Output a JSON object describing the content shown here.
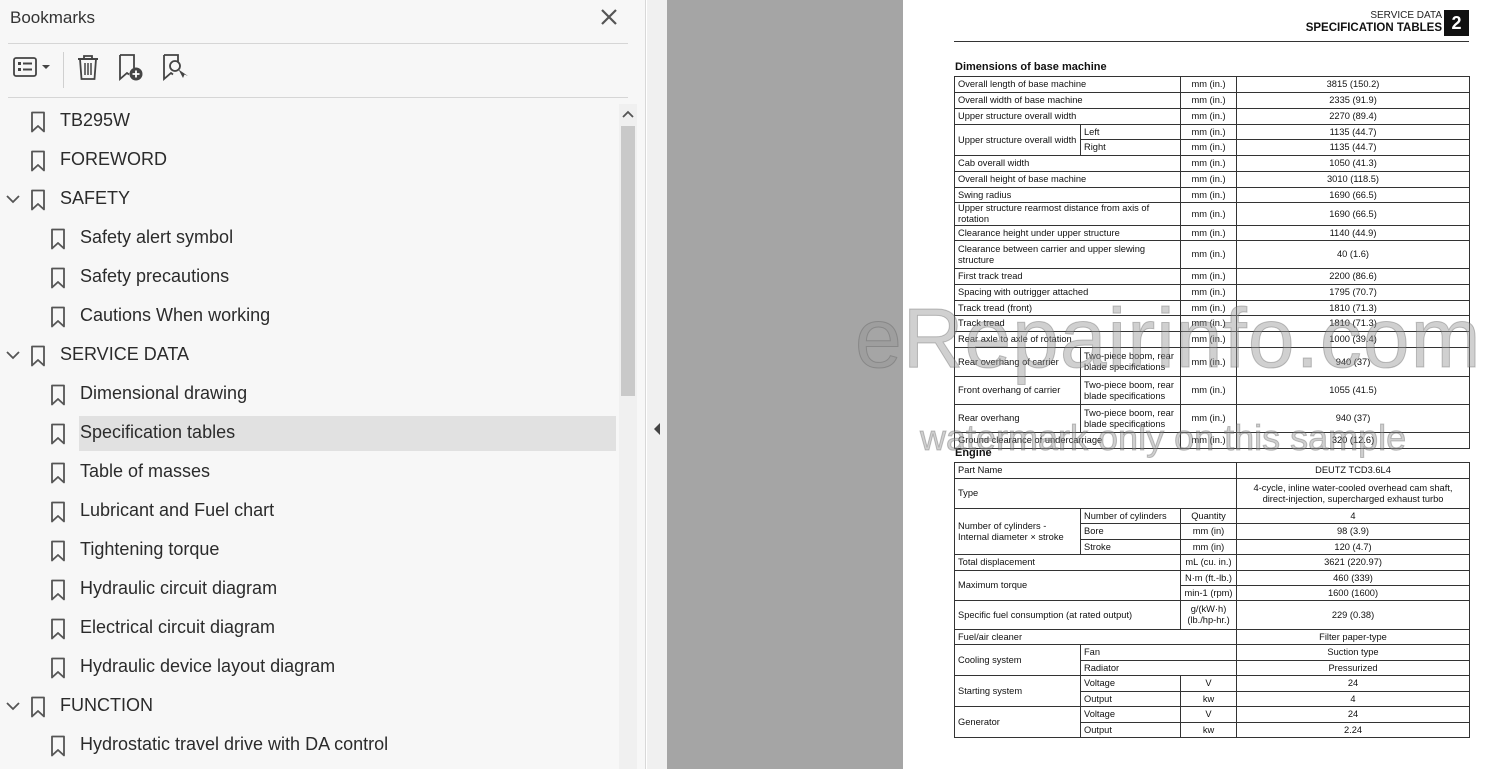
{
  "bookmarks_panel": {
    "title": "Bookmarks",
    "items": [
      {
        "label": "TB295W",
        "level": 0,
        "expanded": false,
        "selected": false
      },
      {
        "label": "FOREWORD",
        "level": 0,
        "expanded": false,
        "selected": false
      },
      {
        "label": "SAFETY",
        "level": 0,
        "expanded": true,
        "selected": false
      },
      {
        "label": "Safety alert symbol",
        "level": 1,
        "selected": false
      },
      {
        "label": "Safety precautions",
        "level": 1,
        "selected": false
      },
      {
        "label": "Cautions When working",
        "level": 1,
        "selected": false
      },
      {
        "label": "SERVICE DATA",
        "level": 0,
        "expanded": true,
        "selected": false
      },
      {
        "label": "Dimensional drawing",
        "level": 1,
        "selected": false
      },
      {
        "label": "Specification tables",
        "level": 1,
        "selected": true
      },
      {
        "label": "Table of masses",
        "level": 1,
        "selected": false
      },
      {
        "label": "Lubricant and Fuel chart",
        "level": 1,
        "selected": false
      },
      {
        "label": "Tightening torque",
        "level": 1,
        "selected": false
      },
      {
        "label": "Hydraulic circuit diagram",
        "level": 1,
        "selected": false
      },
      {
        "label": "Electrical circuit diagram",
        "level": 1,
        "selected": false
      },
      {
        "label": "Hydraulic device layout diagram",
        "level": 1,
        "selected": false
      },
      {
        "label": "FUNCTION",
        "level": 0,
        "expanded": true,
        "selected": false
      },
      {
        "label": "Hydrostatic travel drive with DA control",
        "level": 1,
        "selected": false
      }
    ],
    "toolbar_icons": [
      "options-menu-icon",
      "delete-icon",
      "add-bookmark-icon",
      "find-bookmark-icon"
    ]
  },
  "document": {
    "header": {
      "section": "SERVICE DATA",
      "title": "SPECIFICATION TABLES",
      "chapter_number": "2"
    },
    "dimensions": {
      "title": "Dimensions of base machine",
      "rows": [
        {
          "item": "Overall length of base machine",
          "sub": "",
          "unit": "mm (in.)",
          "value": "3815 (150.2)"
        },
        {
          "item": "Overall width of base machine",
          "sub": "",
          "unit": "mm (in.)",
          "value": "2335 (91.9)"
        },
        {
          "item": "Upper structure overall width",
          "sub": "",
          "unit": "mm (in.)",
          "value": "2270 (89.4)"
        },
        {
          "item": "Upper structure overall width",
          "sub": "Left",
          "unit": "mm (in.)",
          "value": "1135 (44.7)"
        },
        {
          "item": "",
          "sub": "Right",
          "unit": "mm (in.)",
          "value": "1135 (44.7)"
        },
        {
          "item": "Cab overall width",
          "sub": "",
          "unit": "mm (in.)",
          "value": "1050 (41.3)"
        },
        {
          "item": "Overall height of base machine",
          "sub": "",
          "unit": "mm (in.)",
          "value": "3010 (118.5)"
        },
        {
          "item": "Swing radius",
          "sub": "",
          "unit": "mm (in.)",
          "value": "1690 (66.5)"
        },
        {
          "item": "Upper structure rearmost distance from axis of rotation",
          "sub": "",
          "unit": "mm (in.)",
          "value": "1690 (66.5)"
        },
        {
          "item": "Clearance height under upper structure",
          "sub": "",
          "unit": "mm (in.)",
          "value": "1140 (44.9)"
        },
        {
          "item": "Clearance between carrier and upper slewing structure",
          "sub": "",
          "unit": "mm (in.)",
          "value": "40 (1.6)"
        },
        {
          "item": "First track tread",
          "sub": "",
          "unit": "mm (in.)",
          "value": "2200 (86.6)"
        },
        {
          "item": "Spacing with outrigger attached",
          "sub": "",
          "unit": "mm (in.)",
          "value": "1795 (70.7)"
        },
        {
          "item": "Track tread (front)",
          "sub": "",
          "unit": "mm (in.)",
          "value": "1810 (71.3)"
        },
        {
          "item": "Track tread",
          "sub": "",
          "unit": "mm (in.)",
          "value": "1810 (71.3)"
        },
        {
          "item": "Rear axle to axle of rotation",
          "sub": "",
          "unit": "mm (in.)",
          "value": "1000 (39.4)"
        },
        {
          "item": "Rear overhang of carrier",
          "sub": "Two-piece boom, rear blade specifications",
          "unit": "mm (in.)",
          "value": "940 (37)"
        },
        {
          "item": "Front overhang of carrier",
          "sub": "Two-piece boom, rear blade specifications",
          "unit": "mm (in.)",
          "value": "1055 (41.5)"
        },
        {
          "item": "Rear overhang",
          "sub": "Two-piece boom, rear blade specifications",
          "unit": "mm (in.)",
          "value": "940 (37)"
        },
        {
          "item": "Ground clearance of undercarriage",
          "sub": "",
          "unit": "mm (in.)",
          "value": "320 (12.6)"
        }
      ]
    },
    "engine": {
      "title": "Engine",
      "part_name": {
        "label": "Part Name",
        "value": "DEUTZ TCD3.6L4"
      },
      "type": {
        "label": "Type",
        "value": "4-cycle, inline water-cooled overhead cam shaft, direct-injection, supercharged exhaust turbo"
      },
      "cylinders": {
        "label": "Number of cylinders - Internal diameter × stroke",
        "rows": [
          {
            "sub": "Number of cylinders",
            "unit": "Quantity",
            "value": "4"
          },
          {
            "sub": "Bore",
            "unit": "mm (in)",
            "value": "98 (3.9)"
          },
          {
            "sub": "Stroke",
            "unit": "mm (in)",
            "value": "120 (4.7)"
          }
        ]
      },
      "displacement": {
        "label": "Total displacement",
        "unit": "mL (cu. in.)",
        "value": "3621 (220.97)"
      },
      "torque": {
        "label": "Maximum torque",
        "unit1": "N·m (ft.-lb.)",
        "value1": "460 (339)",
        "unit2": "min-1 (rpm)",
        "value2": "1600 (1600)"
      },
      "fuel_consumption": {
        "label": "Specific fuel consumption (at rated output)",
        "unit": "g/(kW·h) (lb./hp-hr.)",
        "value": "229 (0.38)"
      },
      "air_cleaner": {
        "label": "Fuel/air cleaner",
        "value": "Filter paper-type"
      },
      "cooling": {
        "label": "Cooling system",
        "rows": [
          {
            "sub": "Fan",
            "value": "Suction type"
          },
          {
            "sub": "Radiator",
            "value": "Pressurized"
          }
        ]
      },
      "starting": {
        "label": "Starting system",
        "rows": [
          {
            "sub": "Voltage",
            "unit": "V",
            "value": "24"
          },
          {
            "sub": "Output",
            "unit": "kw",
            "value": "4"
          }
        ]
      },
      "generator": {
        "label": "Generator",
        "rows": [
          {
            "sub": "Voltage",
            "unit": "V",
            "value": "24"
          },
          {
            "sub": "Output",
            "unit": "kw",
            "value": "2.24"
          }
        ]
      }
    },
    "watermark": {
      "line1": "eRepairinfo.com",
      "line2": "watermark only on this sample"
    }
  }
}
